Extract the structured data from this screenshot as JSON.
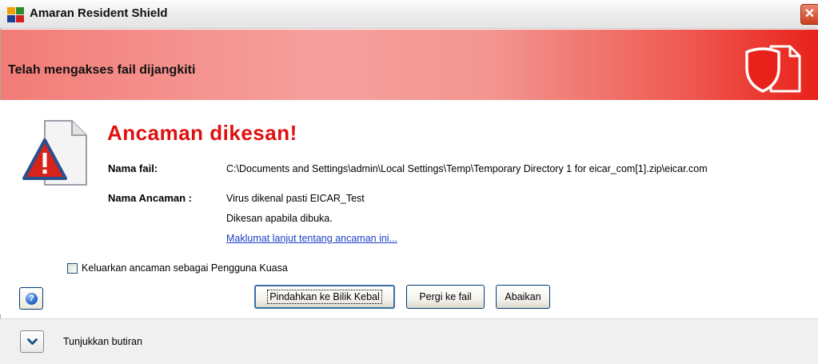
{
  "window": {
    "title": "Amaran Resident Shield",
    "close_glyph": "✕"
  },
  "banner": {
    "heading": "Telah mengakses fail dijangkiti"
  },
  "alert": {
    "title": "Ancaman dikesan!",
    "file_label": "Nama fail:",
    "file_value": "C:\\Documents and Settings\\admin\\Local Settings\\Temp\\Temporary Directory 1 for eicar_com[1].zip\\eicar.com",
    "threat_label": "Nama Ancaman :",
    "threat_value": "Virus dikenal pasti EICAR_Test",
    "detected_on": "Dikesan apabila dibuka.",
    "more_info_link": "Maklumat lanjut tentang ancaman ini..."
  },
  "options": {
    "poweruser_checkbox_label": "Keluarkan ancaman sebagai Pengguna Kuasa",
    "poweruser_checked": false
  },
  "buttons": {
    "help": "?",
    "move_to_vault": "Pindahkan ke Bilik Kebal",
    "go_to_file": "Pergi ke fail",
    "ignore": "Abaikan"
  },
  "footer": {
    "show_details": "Tunjukkan butiran"
  },
  "icons": {
    "app": "avg-logo-icon",
    "banner": "shield-document-icon",
    "alert": "warning-document-icon",
    "expand": "chevron-down-icon"
  },
  "colors": {
    "alert_title": "#e01010",
    "link": "#1a3fc4",
    "banner_end": "#e8221a"
  }
}
